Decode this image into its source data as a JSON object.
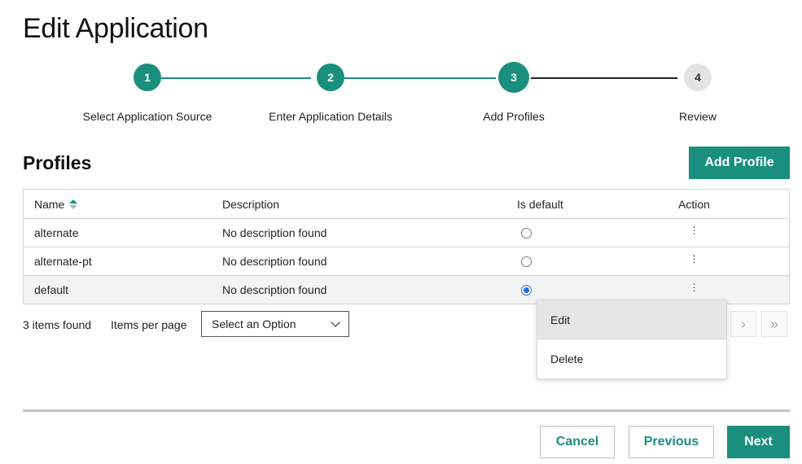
{
  "page": {
    "title": "Edit Application"
  },
  "stepper": {
    "steps": [
      {
        "number": "1",
        "label": "Select Application Source",
        "state": "done"
      },
      {
        "number": "2",
        "label": "Enter Application Details",
        "state": "done"
      },
      {
        "number": "3",
        "label": "Add Profiles",
        "state": "active"
      },
      {
        "number": "4",
        "label": "Review",
        "state": "todo"
      }
    ]
  },
  "profiles": {
    "title": "Profiles",
    "add_label": "Add Profile",
    "columns": {
      "name": "Name",
      "description": "Description",
      "is_default": "Is default",
      "action": "Action"
    },
    "sort": {
      "column": "Name",
      "direction": "ascending"
    },
    "rows": [
      {
        "name": "alternate",
        "description": "No description found",
        "is_default": false,
        "action_icon": "kebab-icon"
      },
      {
        "name": "alternate-pt",
        "description": "No description found",
        "is_default": false,
        "action_icon": "kebab-icon"
      },
      {
        "name": "default",
        "description": "No description found",
        "is_default": true,
        "action_icon": "kebab-icon"
      }
    ]
  },
  "pagination": {
    "items_found": "3 items found",
    "items_per_page_label": "Items per page",
    "select_value": "Select an Option",
    "next_icon": "chevron-right-icon",
    "last_icon": "double-chevron-right-icon"
  },
  "action_menu": {
    "items": [
      {
        "label": "Edit",
        "hovered": true
      },
      {
        "label": "Delete",
        "hovered": false
      }
    ]
  },
  "footer": {
    "cancel_label": "Cancel",
    "previous_label": "Previous",
    "next_label": "Next"
  },
  "colors": {
    "accent": "#1a8f7e",
    "radio_checked": "#1f6fe0"
  }
}
